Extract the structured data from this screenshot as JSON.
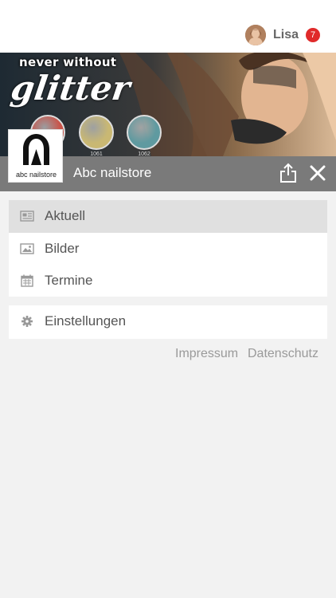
{
  "header": {
    "username": "Lisa",
    "notification_count": "7"
  },
  "banner": {
    "tagline": "never without",
    "headline": "glitter",
    "swatches": [
      {
        "code": "",
        "color": "#c9544a"
      },
      {
        "code": "1061",
        "color": "#c9b873"
      },
      {
        "code": "1062",
        "color": "#5f9aa0"
      }
    ]
  },
  "store": {
    "title": "Abc nailstore",
    "logo_text": "abc nailstore"
  },
  "menu": {
    "items": [
      {
        "label": "Aktuell",
        "icon": "newspaper-icon",
        "active": true
      },
      {
        "label": "Bilder",
        "icon": "image-icon",
        "active": false
      },
      {
        "label": "Termine",
        "icon": "calendar-icon",
        "active": false
      }
    ],
    "settings": {
      "label": "Einstellungen",
      "icon": "gear-icon"
    }
  },
  "footer": {
    "impressum": "Impressum",
    "datenschutz": "Datenschutz"
  },
  "colors": {
    "titlebar": "#7a7a7a",
    "badge": "#e02a2a",
    "active_row": "#e0e0e0"
  }
}
